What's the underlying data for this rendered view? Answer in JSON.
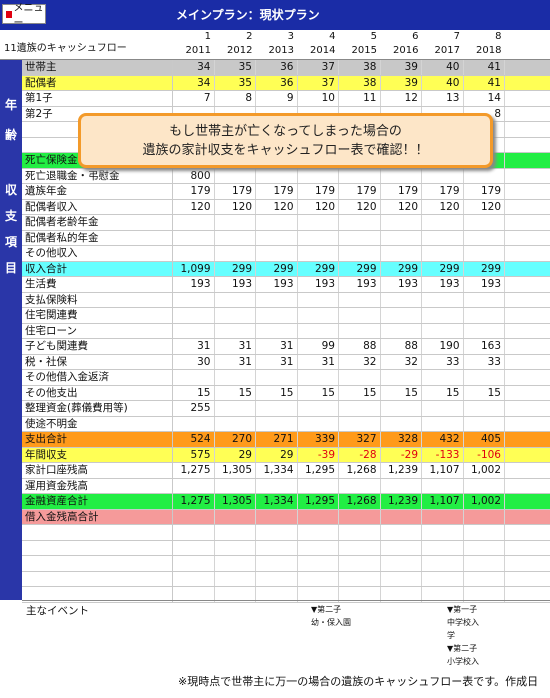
{
  "menu_label": "メニュー",
  "title": "メインプラン：現状プラン",
  "sheet_label": "11遺族のキャッシュフロー",
  "year_index": [
    "1",
    "2",
    "3",
    "4",
    "5",
    "6",
    "7",
    "8"
  ],
  "years": [
    "2011",
    "2012",
    "2013",
    "2014",
    "2015",
    "2016",
    "2017",
    "2018"
  ],
  "band_labels": {
    "age": [
      "年",
      "齢"
    ],
    "cash": [
      "収",
      "支",
      "項",
      "目"
    ]
  },
  "rows": [
    {
      "label": "世帯主",
      "bg": "gray",
      "values": [
        "34",
        "35",
        "36",
        "37",
        "38",
        "39",
        "40",
        "41"
      ]
    },
    {
      "label": "配偶者",
      "bg": "yellow",
      "values": [
        "34",
        "35",
        "36",
        "37",
        "38",
        "39",
        "40",
        "41"
      ]
    },
    {
      "label": "第1子",
      "bg": "",
      "values": [
        "7",
        "8",
        "9",
        "10",
        "11",
        "12",
        "13",
        "14"
      ]
    },
    {
      "label": "第2子",
      "bg": "",
      "values": [
        "",
        "",
        "",
        "",
        "",
        "",
        "",
        "8"
      ]
    },
    {
      "label": "",
      "bg": "",
      "values": [
        "",
        "",
        "",
        "",
        "",
        "",
        "",
        ""
      ]
    },
    {
      "label": "",
      "bg": "",
      "values": [
        "",
        "",
        "",
        "",
        "",
        "",
        "",
        ""
      ]
    },
    {
      "label": "死亡保険金",
      "bg": "green",
      "values": [
        "",
        "",
        "",
        "",
        "",
        "",
        "",
        ""
      ]
    },
    {
      "label": "死亡退職金・弔慰金",
      "bg": "",
      "values": [
        "800",
        "",
        "",
        "",
        "",
        "",
        "",
        ""
      ]
    },
    {
      "label": "遺族年金",
      "bg": "",
      "values": [
        "179",
        "179",
        "179",
        "179",
        "179",
        "179",
        "179",
        "179"
      ]
    },
    {
      "label": "配偶者収入",
      "bg": "",
      "values": [
        "120",
        "120",
        "120",
        "120",
        "120",
        "120",
        "120",
        "120"
      ]
    },
    {
      "label": "配偶者老齢年金",
      "bg": "",
      "values": [
        "",
        "",
        "",
        "",
        "",
        "",
        "",
        ""
      ]
    },
    {
      "label": "配偶者私的年金",
      "bg": "",
      "values": [
        "",
        "",
        "",
        "",
        "",
        "",
        "",
        ""
      ]
    },
    {
      "label": "その他収入",
      "bg": "",
      "values": [
        "",
        "",
        "",
        "",
        "",
        "",
        "",
        ""
      ]
    },
    {
      "label": "収入合計",
      "bg": "cyan",
      "values": [
        "1,099",
        "299",
        "299",
        "299",
        "299",
        "299",
        "299",
        "299"
      ]
    },
    {
      "label": "生活費",
      "bg": "",
      "values": [
        "193",
        "193",
        "193",
        "193",
        "193",
        "193",
        "193",
        "193"
      ]
    },
    {
      "label": "支払保険料",
      "bg": "",
      "values": [
        "",
        "",
        "",
        "",
        "",
        "",
        "",
        ""
      ]
    },
    {
      "label": "住宅関連費",
      "bg": "",
      "values": [
        "",
        "",
        "",
        "",
        "",
        "",
        "",
        ""
      ]
    },
    {
      "label": "住宅ローン",
      "bg": "",
      "values": [
        "",
        "",
        "",
        "",
        "",
        "",
        "",
        ""
      ]
    },
    {
      "label": "子ども関連費",
      "bg": "",
      "values": [
        "31",
        "31",
        "31",
        "99",
        "88",
        "88",
        "190",
        "163"
      ]
    },
    {
      "label": "税・社保",
      "bg": "",
      "values": [
        "30",
        "31",
        "31",
        "31",
        "32",
        "32",
        "33",
        "33"
      ]
    },
    {
      "label": "その他借入金返済",
      "bg": "",
      "values": [
        "",
        "",
        "",
        "",
        "",
        "",
        "",
        ""
      ]
    },
    {
      "label": "その他支出",
      "bg": "",
      "values": [
        "15",
        "15",
        "15",
        "15",
        "15",
        "15",
        "15",
        "15"
      ]
    },
    {
      "label": "整理資金(葬儀費用等)",
      "bg": "",
      "values": [
        "255",
        "",
        "",
        "",
        "",
        "",
        "",
        ""
      ]
    },
    {
      "label": "使途不明金",
      "bg": "",
      "values": [
        "",
        "",
        "",
        "",
        "",
        "",
        "",
        ""
      ]
    },
    {
      "label": "支出合計",
      "bg": "orange",
      "values": [
        "524",
        "270",
        "271",
        "339",
        "327",
        "328",
        "432",
        "405"
      ]
    },
    {
      "label": "年間収支",
      "bg": "yellow",
      "values": [
        "575",
        "29",
        "29",
        "-39",
        "-28",
        "-29",
        "-133",
        "-106"
      ]
    },
    {
      "label": "家計口座残高",
      "bg": "",
      "values": [
        "1,275",
        "1,305",
        "1,334",
        "1,295",
        "1,268",
        "1,239",
        "1,107",
        "1,002"
      ]
    },
    {
      "label": "運用資金残高",
      "bg": "",
      "values": [
        "",
        "",
        "",
        "",
        "",
        "",
        "",
        ""
      ]
    },
    {
      "label": "金融資産合計",
      "bg": "green",
      "values": [
        "1,275",
        "1,305",
        "1,334",
        "1,295",
        "1,268",
        "1,239",
        "1,107",
        "1,002"
      ]
    },
    {
      "label": "借入金残高合計",
      "bg": "pink",
      "values": [
        "",
        "",
        "",
        "",
        "",
        "",
        "",
        ""
      ]
    },
    {
      "label": "",
      "bg": "",
      "values": [
        "",
        "",
        "",
        "",
        "",
        "",
        "",
        ""
      ]
    },
    {
      "label": "",
      "bg": "",
      "values": [
        "",
        "",
        "",
        "",
        "",
        "",
        "",
        ""
      ]
    },
    {
      "label": "",
      "bg": "",
      "values": [
        "",
        "",
        "",
        "",
        "",
        "",
        "",
        ""
      ]
    },
    {
      "label": "",
      "bg": "",
      "values": [
        "",
        "",
        "",
        "",
        "",
        "",
        "",
        ""
      ]
    },
    {
      "label": "",
      "bg": "",
      "values": [
        "",
        "",
        "",
        "",
        "",
        "",
        "",
        ""
      ]
    }
  ],
  "callout": {
    "line1": "もし世帯主が亡くなってしまった場合の",
    "line2": "遺族の家計収支をキャッシュフロー表で確認！！"
  },
  "events": {
    "label": "主なイベント",
    "col4": [
      "▼第二子",
      "幼・保入園"
    ],
    "col7": [
      "▼第一子",
      "中学校入",
      "学",
      "▼第二子",
      "小学校入"
    ]
  },
  "footer": "※現時点で世帯主に万一の場合の遺族のキャッシュフロー表です。作成日"
}
